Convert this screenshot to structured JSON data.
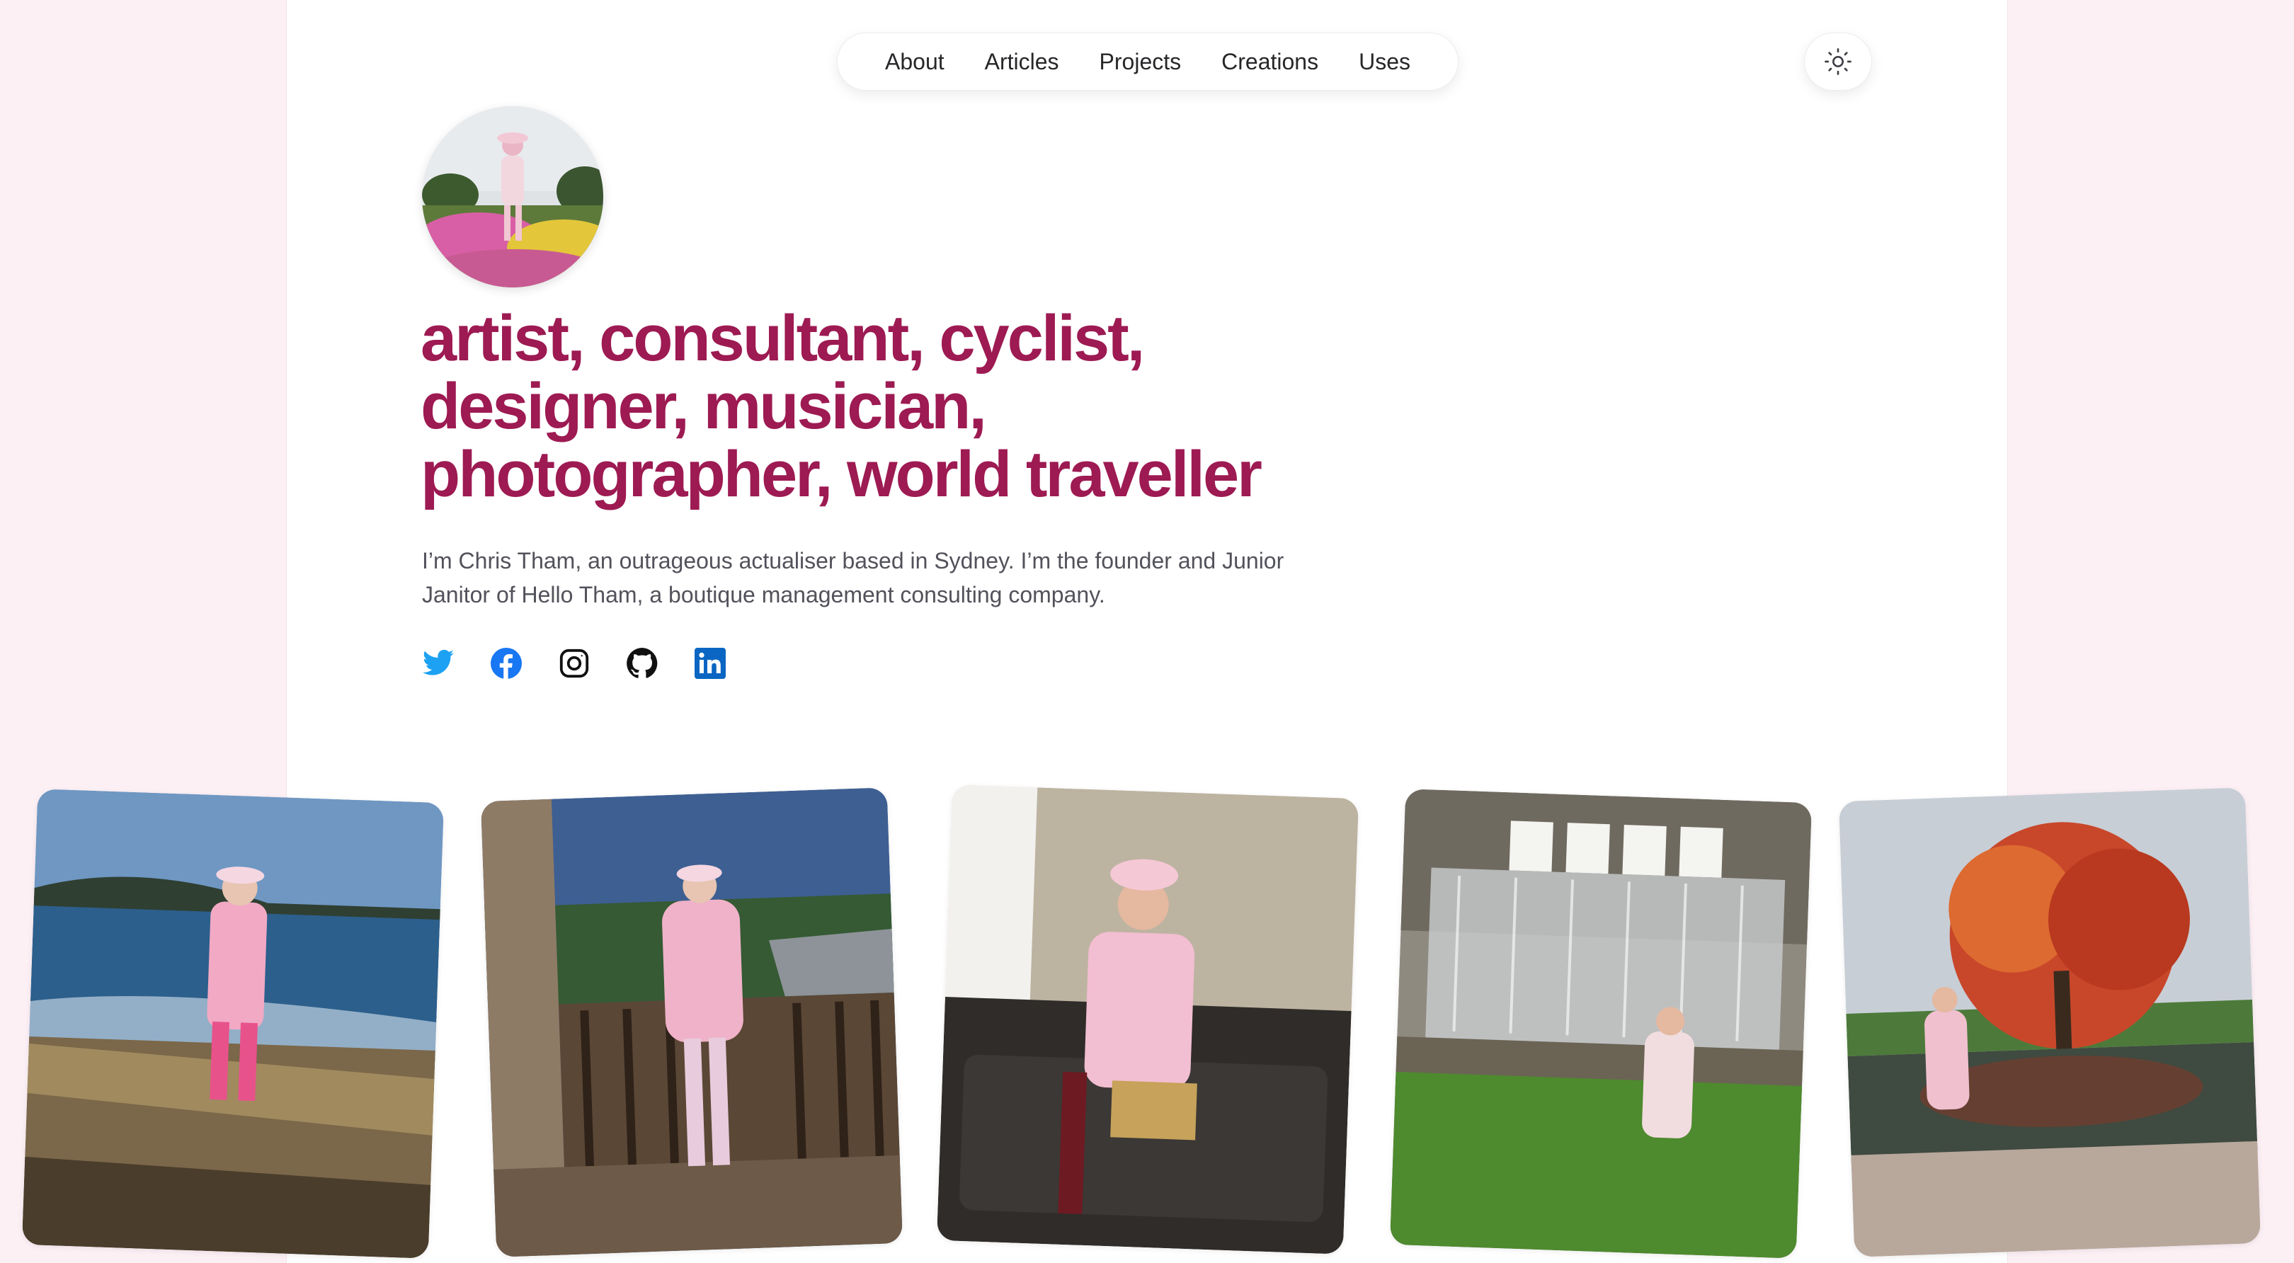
{
  "nav": {
    "items": [
      {
        "label": "About"
      },
      {
        "label": "Articles"
      },
      {
        "label": "Projects"
      },
      {
        "label": "Creations"
      },
      {
        "label": "Uses"
      }
    ],
    "theme_toggle_icon": "sun-icon"
  },
  "profile": {
    "avatar_icon": "avatar-photo",
    "headline_lines": [
      "artist, consultant, cyclist,",
      "designer, musician,",
      "photographer, world traveller"
    ],
    "intro": "I’m Chris Tham, an outrageous actualiser based in Sydney. I’m the founder and Junior Janitor of Hello Tham, a boutique management consulting company."
  },
  "socials": [
    {
      "icon": "twitter-icon",
      "color": "#1da1f2"
    },
    {
      "icon": "facebook-icon",
      "color": "#1877f2"
    },
    {
      "icon": "instagram-icon",
      "color": "#111111"
    },
    {
      "icon": "github-icon",
      "color": "#111111"
    },
    {
      "icon": "linkedin-icon",
      "color": "#0a66c2"
    }
  ],
  "colors": {
    "accent": "#9d1a52",
    "page_bg": "#fcf0f5",
    "card_bg": "#ffffff",
    "text_muted": "#52525b"
  },
  "photos": [
    {
      "name": "photo-coast-rocks"
    },
    {
      "name": "photo-deck-trees"
    },
    {
      "name": "photo-sofa-indoors"
    },
    {
      "name": "photo-weir-waterfall"
    },
    {
      "name": "photo-autumn-tree-pond"
    }
  ]
}
